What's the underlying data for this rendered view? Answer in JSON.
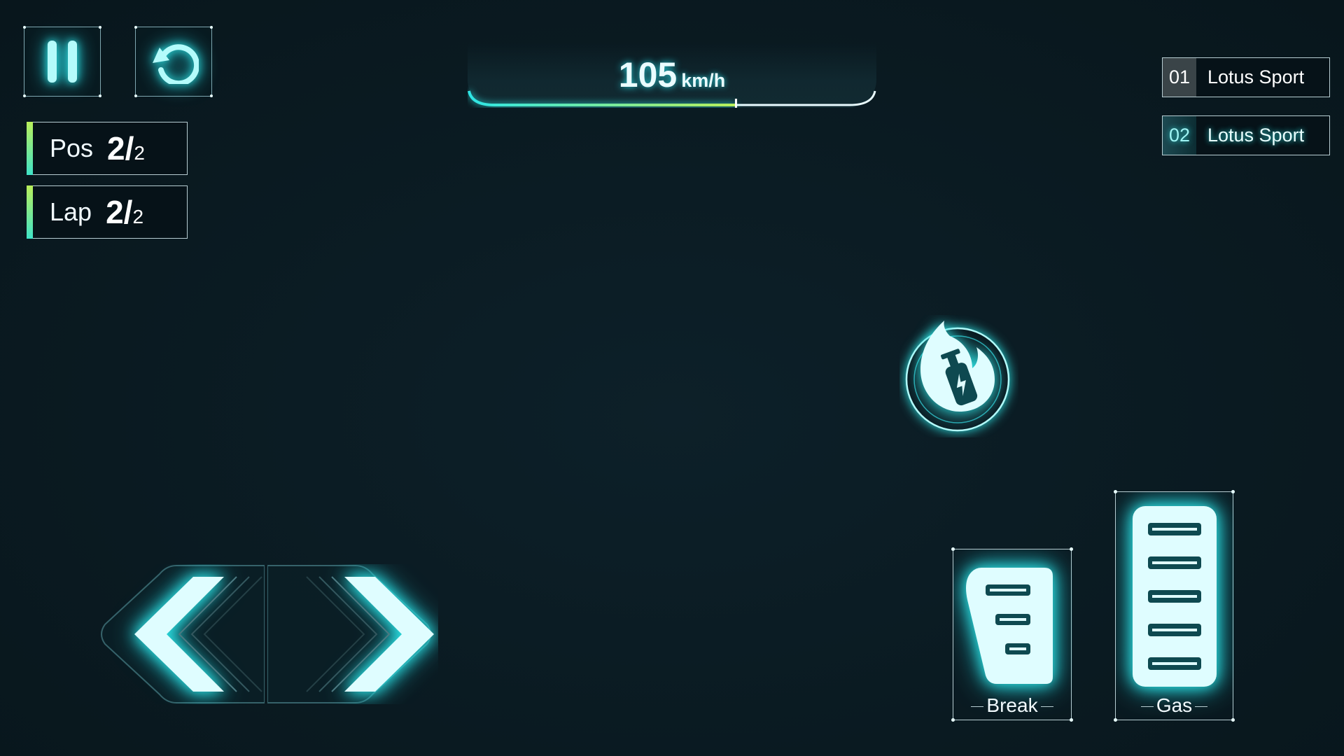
{
  "hud": {
    "pause_icon": "pause-icon",
    "restart_icon": "restart-icon",
    "position": {
      "label": "Pos",
      "current": "2",
      "total": "/2"
    },
    "lap": {
      "label": "Lap",
      "current": "2",
      "total": "/2"
    }
  },
  "speedometer": {
    "value": "105",
    "unit": "km/h",
    "fill_fraction": 0.68,
    "accent_color": "#2ee6e6",
    "progress_end_color": "#b9ef5a"
  },
  "leaderboard": [
    {
      "rank": "01",
      "name": "Lotus Sport"
    },
    {
      "rank": "02",
      "name": "Lotus Sport"
    }
  ],
  "controls": {
    "nitro_icon": "nitro-bottle-icon",
    "steer_left_icon": "chevron-left-icon",
    "steer_right_icon": "chevron-right-icon",
    "brake_label": "Break",
    "gas_label": "Gas"
  },
  "colors": {
    "background": "#0a1a21",
    "glow": "#2ee6e6",
    "panel_border": "#b7cdd2"
  }
}
